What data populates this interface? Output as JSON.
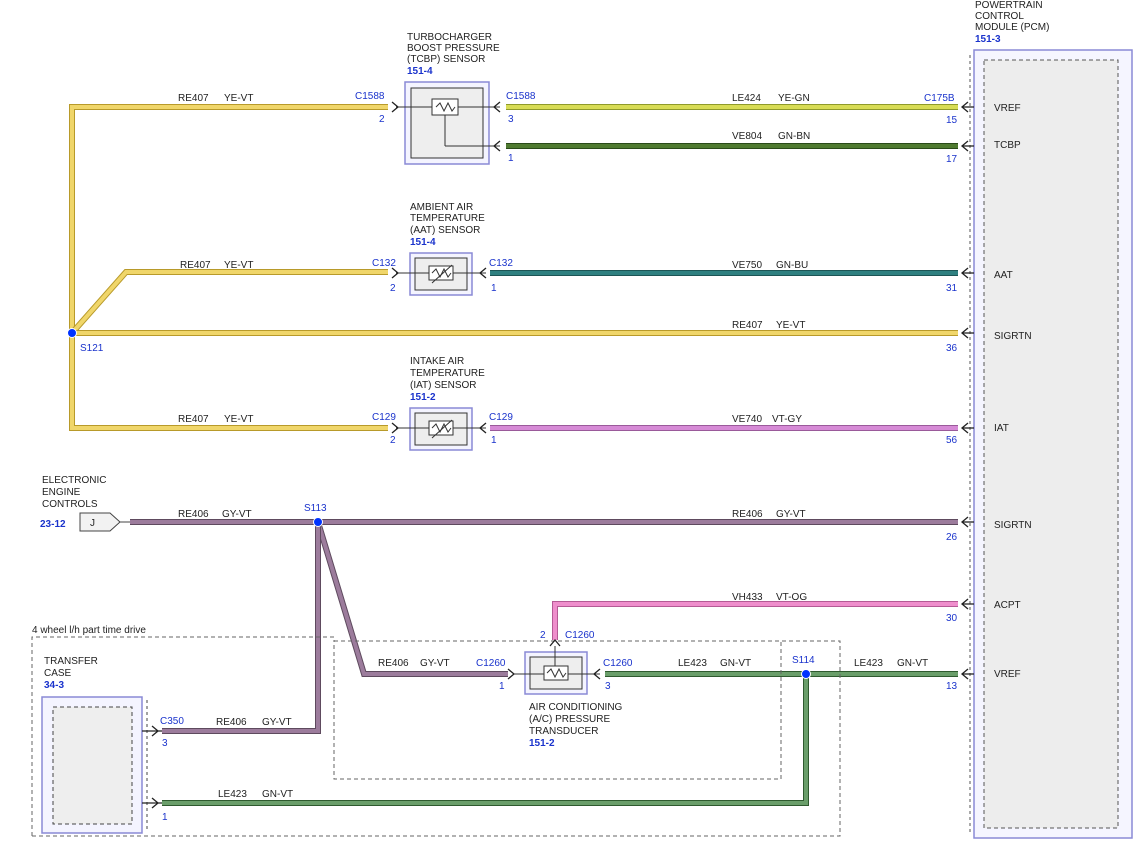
{
  "colors": {
    "YE-VT": "#e8c84a",
    "YE-GN": "#cfd24a",
    "GN-BN": "#3d6b2a",
    "GN-BU": "#2b7373",
    "VT-GY": "#c97ac9",
    "GY-VT": "#8a6a8a",
    "VT-OG": "#e27bc0",
    "GN-VT": "#4f8a4f",
    "connector_blue": "#1a33cc",
    "splice": "#0033ff",
    "box_border": "#8a8ad6"
  },
  "pcm": {
    "title_lines": [
      "POWERTRAIN",
      "CONTROL",
      "MODULE (PCM)"
    ],
    "ref": "151-3",
    "connector": "C175B",
    "pins": [
      {
        "name": "VREF",
        "num": "15"
      },
      {
        "name": "TCBP",
        "num": "17"
      },
      {
        "name": "AAT",
        "num": "31"
      },
      {
        "name": "SIGRTN",
        "num": "36"
      },
      {
        "name": "IAT",
        "num": "56"
      },
      {
        "name": "SIGRTN",
        "num": "26"
      },
      {
        "name": "ACPT",
        "num": "30"
      },
      {
        "name": "VREF",
        "num": "13"
      }
    ]
  },
  "tcbp": {
    "title_lines": [
      "TURBOCHARGER",
      "BOOST PRESSURE",
      "(TCBP) SENSOR"
    ],
    "ref": "151-4",
    "conn_left": "C1588",
    "conn_right": "C1588",
    "pin_in": "2",
    "pin_out_top": "3",
    "pin_out_bottom": "1"
  },
  "aat": {
    "title_lines": [
      "AMBIENT AIR",
      "TEMPERATURE",
      "(AAT) SENSOR"
    ],
    "ref": "151-4",
    "conn_left": "C132",
    "conn_right": "C132",
    "pin_in": "2",
    "pin_out": "1"
  },
  "iat": {
    "title_lines": [
      "INTAKE AIR",
      "TEMPERATURE",
      "(IAT) SENSOR"
    ],
    "ref": "151-2",
    "conn_left": "C129",
    "conn_right": "C129",
    "pin_in": "2",
    "pin_out": "1"
  },
  "acpt": {
    "title_lines": [
      "AIR CONDITIONING",
      "(A/C) PRESSURE",
      "TRANSDUCER"
    ],
    "ref": "151-2",
    "conn_left": "C1260",
    "conn_top": "C1260",
    "conn_right": "C1260",
    "pin_left": "1",
    "pin_top": "2",
    "pin_right": "3"
  },
  "eec": {
    "title_lines": [
      "ELECTRONIC",
      "ENGINE",
      "CONTROLS"
    ],
    "ref": "23-12",
    "tag": "J"
  },
  "transfer": {
    "note": "4 wheel l/h part time drive",
    "title_lines": [
      "TRANSFER",
      "CASE"
    ],
    "ref": "34-3",
    "conn": "C350",
    "pin_top": "3",
    "pin_bottom": "1"
  },
  "splices": {
    "s121": "S121",
    "s113": "S113",
    "s114": "S114"
  },
  "wires": {
    "w1_left": {
      "circuit": "RE407",
      "color": "YE-VT"
    },
    "w1_right": {
      "circuit": "LE424",
      "color": "YE-GN"
    },
    "w2_right": {
      "circuit": "VE804",
      "color": "GN-BN"
    },
    "w3_left": {
      "circuit": "RE407",
      "color": "YE-VT"
    },
    "w3_right": {
      "circuit": "VE750",
      "color": "GN-BU"
    },
    "w4": {
      "circuit": "RE407",
      "color": "YE-VT"
    },
    "w5_left": {
      "circuit": "RE407",
      "color": "YE-VT"
    },
    "w5_right": {
      "circuit": "VE740",
      "color": "VT-GY"
    },
    "w6_left": {
      "circuit": "RE406",
      "color": "GY-VT"
    },
    "w6_right": {
      "circuit": "RE406",
      "color": "GY-VT"
    },
    "w7": {
      "circuit": "VH433",
      "color": "VT-OG"
    },
    "w8_left": {
      "circuit": "RE406",
      "color": "GY-VT"
    },
    "w8_mid": {
      "circuit": "LE423",
      "color": "GN-VT"
    },
    "w8_right": {
      "circuit": "LE423",
      "color": "GN-VT"
    },
    "w9": {
      "circuit": "RE406",
      "color": "GY-VT"
    },
    "w10": {
      "circuit": "LE423",
      "color": "GN-VT"
    }
  }
}
